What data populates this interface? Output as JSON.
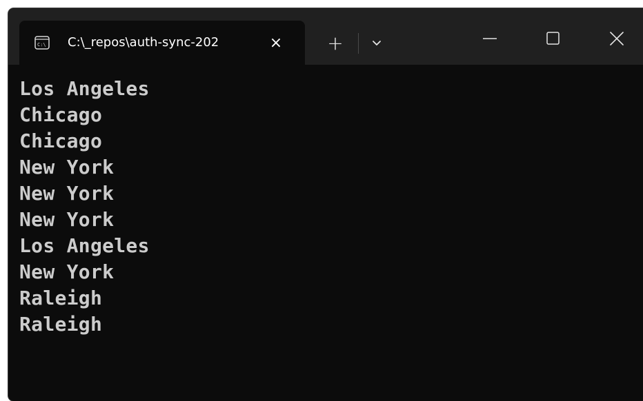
{
  "window": {
    "tab_title": "C:\\_repos\\auth-sync-202",
    "tab_icon": "console-icon",
    "buttons": {
      "close_tab": "×",
      "new_tab": "+",
      "dropdown": "chevron-down-icon",
      "minimize": "minimize-icon",
      "maximize": "maximize-icon",
      "close": "close-icon"
    }
  },
  "terminal": {
    "lines": [
      "Los Angeles",
      "Chicago",
      "Chicago",
      "New York",
      "New York",
      "New York",
      "Los Angeles",
      "New York",
      "Raleigh",
      "Raleigh"
    ],
    "text_color": "#cccccc",
    "background": "#0c0c0c"
  }
}
